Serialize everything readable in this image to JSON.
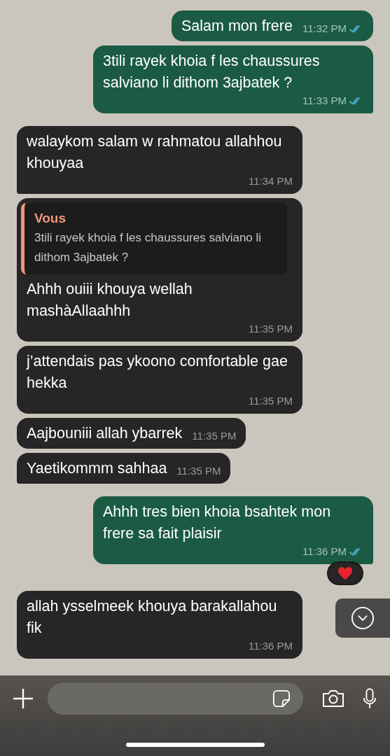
{
  "messages": [
    {
      "outgoing": true,
      "text": "Salam mon frere",
      "time": "11:32 PM",
      "read": true,
      "tail": false
    },
    {
      "outgoing": true,
      "text": "3tili rayek khoia f les chaussures salviano li dithom 3ajbatek ?",
      "time": "11:33 PM",
      "read": true,
      "tail": true
    },
    {
      "outgoing": false,
      "text": "walaykom salam w rahmatou allahhou khouyaa",
      "time": "11:34 PM",
      "tail": true
    },
    {
      "outgoing": false,
      "quote": {
        "author": "Vous",
        "text": "3tili rayek khoia f les chaussures salviano li dithom 3ajbatek ?"
      },
      "text": "Ahhh ouiii khouya wellah mashàAllaahhh",
      "time": "11:35 PM",
      "tail": false
    },
    {
      "outgoing": false,
      "text": "j’attendais pas ykoono comfortable gae hekka",
      "time": "11:35 PM",
      "tail": false
    },
    {
      "outgoing": false,
      "text": "Aajbouniii allah ybarrek",
      "time": "11:35 PM",
      "tail": false
    },
    {
      "outgoing": false,
      "text": "Yaetikommm sahhaa",
      "time": "11:35 PM",
      "tail": true
    },
    {
      "outgoing": true,
      "text": "Ahhh tres bien khoia bsahtek mon frere sa fait plaisir",
      "time": "11:36 PM",
      "read": true,
      "tail": true,
      "reaction": {
        "kind": "heart"
      }
    },
    {
      "outgoing": false,
      "text": "allah ysselmeek khouya barakallahou fik",
      "time": "11:36 PM",
      "tail": false
    }
  ]
}
